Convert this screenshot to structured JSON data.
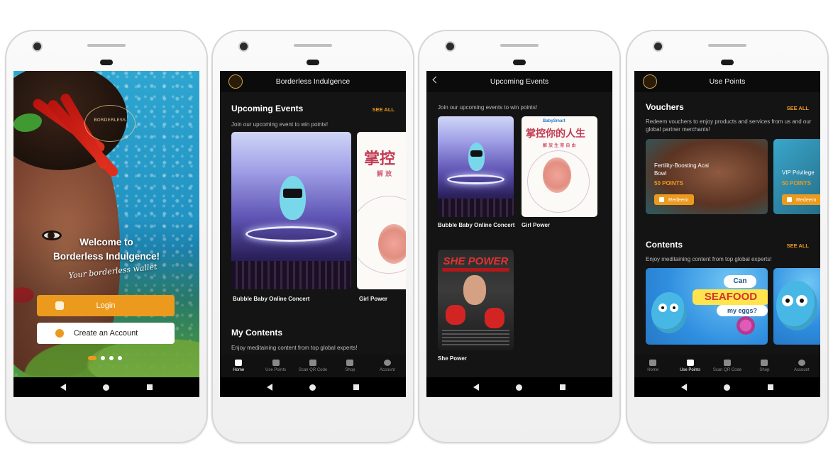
{
  "phone1": {
    "brand_logo_text": "BORDERLESS",
    "welcome_line1": "Welcome to",
    "welcome_line2": "Borderless Indulgence!",
    "tagline": "Your borderless wallet",
    "login_label": "Login",
    "create_account_label": "Create an Account",
    "carousel_active_index": 0,
    "carousel_count": 4
  },
  "phone2": {
    "app_title": "Borderless Indulgence",
    "events_title": "Upcoming Events",
    "see_all": "SEE ALL",
    "events_subtitle": "Join our upcoming event to win points!",
    "events": [
      {
        "caption": "Bubble Baby Online Concert"
      },
      {
        "caption": "Girl Power"
      }
    ],
    "poster_cn": "掌控",
    "poster_cn_sub": "解 放",
    "contents_title": "My Contents",
    "contents_subtitle": "Enjoy meditaining content from top global experts!",
    "nav": [
      "Home",
      "Use Points",
      "Scan QR Code",
      "Shop",
      "Account"
    ],
    "nav_active": "Home"
  },
  "phone3": {
    "title": "Upcoming Events",
    "subtitle": "Join our upcoming events to win points!",
    "events": [
      {
        "caption": "Bubble Baby Online Concert"
      },
      {
        "caption": "Girl Power"
      },
      {
        "caption": "She Power"
      }
    ],
    "poster_brand": "BabySmart",
    "poster_cn": "掌控你的人生",
    "poster_cn_sub": "解 放 生 育 自 由",
    "shepower_title": "SHE POWER"
  },
  "phone4": {
    "title": "Use Points",
    "vouchers_title": "Vouchers",
    "see_all": "SEE ALL",
    "vouchers_subtitle": "Redeem vouchers to enjoy products and services from us and our global partner merchants!",
    "vouchers": [
      {
        "name": "Fertility-Boosting Acai Bowl",
        "points": "50 POINTS",
        "button": "Redeem"
      },
      {
        "name": "VIP Privilege",
        "points": "50 POINTS",
        "button": "Redeem"
      }
    ],
    "contents_title": "Contents",
    "contents_subtitle": "Enjoy meditaining content from top global experts!",
    "seafood_can": "Can",
    "seafood_big": "SEAFOOD",
    "seafood_eggs": "my eggs?",
    "nav": [
      "Home",
      "Use Points",
      "Scan QR Code",
      "Shop",
      "Account"
    ],
    "nav_active": "Use Points"
  },
  "colors": {
    "accent": "#ec9a1e",
    "dark_bg": "#141414",
    "appbar_bg": "#0b0b0b"
  }
}
